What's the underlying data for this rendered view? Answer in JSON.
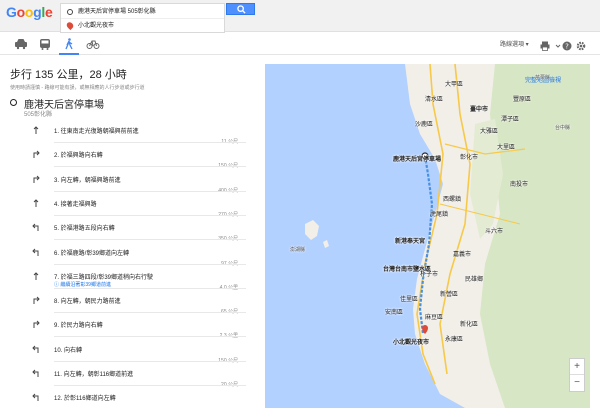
{
  "app": {
    "logo": "Google"
  },
  "search": {
    "origin": "鹿港天后宮停車場 505彰化縣",
    "destination": "小北觀光夜市"
  },
  "toolbar": {
    "route_options": "路線選項 ▾"
  },
  "summary": {
    "title": "步行 135 公里，28 小時",
    "warning": "使用時請謹慎 - 路線可能有誤，或無相應的人行步道或步行道"
  },
  "start": {
    "name": "鹿港天后宮停車場",
    "sub": "505彰化縣"
  },
  "steps": [
    {
      "num": "1.",
      "text": "往東南走光復路朝福興前前進",
      "dist": "11 公尺",
      "note": ""
    },
    {
      "num": "2.",
      "text": "於福興路向右轉",
      "dist": "150 公尺",
      "note": ""
    },
    {
      "num": "3.",
      "text": "向左轉，朝福興路前進",
      "dist": "400 公尺",
      "note": ""
    },
    {
      "num": "4.",
      "text": "接著走福興路",
      "dist": "270 公尺",
      "note": ""
    },
    {
      "num": "5.",
      "text": "於福港路五段向右轉",
      "dist": "350 公尺",
      "note": ""
    },
    {
      "num": "6.",
      "text": "於福鹿路/彰39鄉道向左轉",
      "dist": "97 公尺",
      "note": ""
    },
    {
      "num": "7.",
      "text": "於福三路四段/彰39鄉道稍向右行駛",
      "dist": "4.0 公里",
      "note": "繼續沿著彰39鄉道前進"
    },
    {
      "num": "8.",
      "text": "向左轉，朝民力路前進",
      "dist": "65 公尺",
      "note": ""
    },
    {
      "num": "9.",
      "text": "於民力路向右轉",
      "dist": "2.3 公里",
      "note": ""
    },
    {
      "num": "10.",
      "text": "向右轉",
      "dist": "150 公尺",
      "note": ""
    },
    {
      "num": "11.",
      "text": "向左轉，朝彰116鄉道前進",
      "dist": "20 公尺",
      "note": ""
    },
    {
      "num": "12.",
      "text": "於彰116鄉道向左轉",
      "dist": "",
      "note": ""
    }
  ],
  "map": {
    "view_label": "完整地圖檢視",
    "places": [
      {
        "name": "臺中市",
        "style": "bold"
      },
      {
        "name": "鹿港天后宮停車場",
        "style": "bold"
      },
      {
        "name": "彰化市",
        "style": ""
      },
      {
        "name": "大里區",
        "style": ""
      },
      {
        "name": "南投市",
        "style": ""
      },
      {
        "name": "斗六市",
        "style": ""
      },
      {
        "name": "新港奉天宮",
        "style": "bold"
      },
      {
        "name": "嘉義市",
        "style": ""
      },
      {
        "name": "台灣台南市鹽水區",
        "style": "bold"
      },
      {
        "name": "安南區",
        "style": ""
      },
      {
        "name": "小北觀光夜市",
        "style": "bold"
      },
      {
        "name": "澎湖縣",
        "style": "small"
      },
      {
        "name": "潭子區",
        "style": ""
      },
      {
        "name": "豐原區",
        "style": ""
      },
      {
        "name": "大甲區",
        "style": ""
      },
      {
        "name": "清水區",
        "style": ""
      },
      {
        "name": "沙鹿區",
        "style": ""
      },
      {
        "name": "大雅區",
        "style": ""
      },
      {
        "name": "西螺鎮",
        "style": ""
      },
      {
        "name": "虎尾鎮",
        "style": ""
      },
      {
        "name": "朴子市",
        "style": ""
      },
      {
        "name": "民雄鄉",
        "style": ""
      },
      {
        "name": "新營區",
        "style": ""
      },
      {
        "name": "麻豆區",
        "style": ""
      },
      {
        "name": "佳里區",
        "style": ""
      },
      {
        "name": "新化區",
        "style": ""
      },
      {
        "name": "永康區",
        "style": ""
      },
      {
        "name": "苗栗縣",
        "style": "small"
      },
      {
        "name": "台中縣",
        "style": "small"
      }
    ],
    "zoom_in": "+",
    "zoom_out": "−"
  },
  "colors": {
    "accent": "#4285f4",
    "route": "#4a90e2",
    "land": "#f2efe9",
    "sea": "#b3d1ff",
    "hills": "#d7e6c4"
  }
}
